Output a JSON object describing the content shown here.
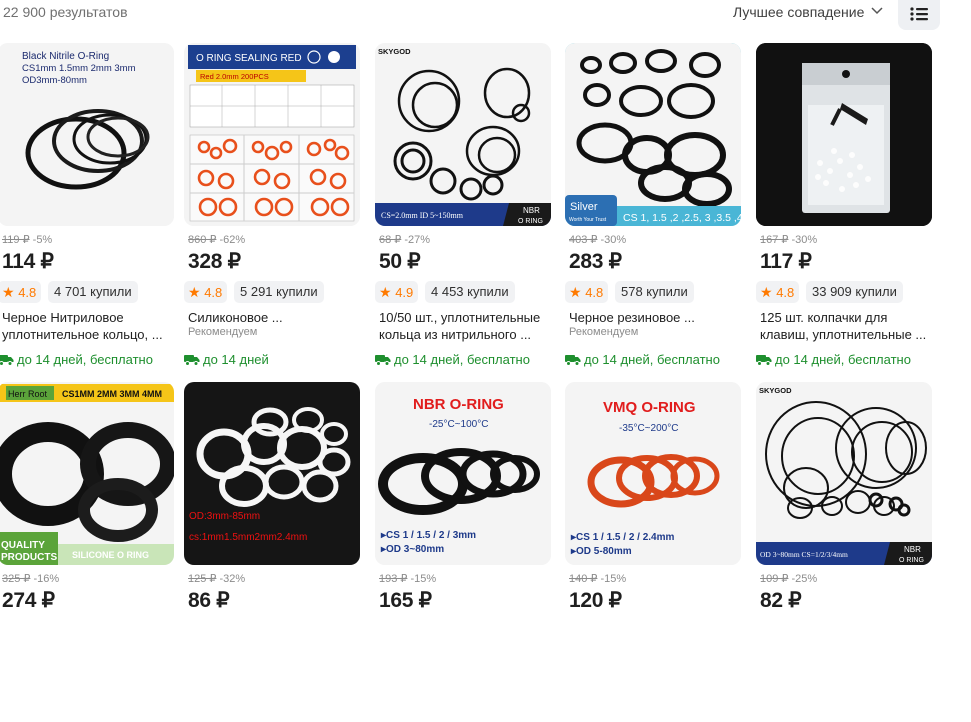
{
  "header": {
    "results": "22 900 результатов",
    "sort_label": "Лучшее совпадение",
    "sort_icon": "chevron-down-icon",
    "view_icon": "list-view-icon"
  },
  "colors": {
    "accent_orange": "#ff7a00",
    "delivery_green": "#1e8f2e",
    "highlight_border": "#7cd3e6"
  },
  "products": [
    {
      "old_price": "119 ₽",
      "discount": "-5%",
      "price": "114 ₽",
      "rating": "4.8",
      "bought": "4 701 купили",
      "title": "Черное Нитриловое уплотнительное кольцо, ...",
      "recommended": "",
      "delivery": "до 14 дней, бесплатно",
      "image_text": [
        "Black Nitrile O-Ring",
        "CS1mm 1.5mm 2mm 3mm",
        "OD3mm-80mm"
      ]
    },
    {
      "old_price": "860 ₽",
      "discount": "-62%",
      "price": "328 ₽",
      "rating": "4.8",
      "bought": "5 291 купили",
      "title": "Силиконовое ...",
      "recommended": "Рекомендуем",
      "delivery": "до 14 дней",
      "image_text": [
        "O RING SEALING RED",
        "Red 2.0mm 200PCS"
      ]
    },
    {
      "old_price": "68 ₽",
      "discount": "-27%",
      "price": "50 ₽",
      "rating": "4.9",
      "bought": "4 453 купили",
      "title": "10/50 шт., уплотнительные кольца из нитрильного ...",
      "recommended": "",
      "delivery": "до 14 дней, бесплатно",
      "image_text": [
        "SKYGOD",
        "CS=2.0mm ID 5~150mm",
        "NBR",
        "O RING"
      ]
    },
    {
      "old_price": "403 ₽",
      "discount": "-30%",
      "price": "283 ₽",
      "rating": "4.8",
      "bought": "578 купили",
      "title": "Черное резиновое ...",
      "recommended": "Рекомендуем",
      "delivery": "до 14 дней, бесплатно",
      "image_text": [
        "Silver",
        "Worth Your Trust",
        "CS 1, 1.5 ,2 ,2.5, 3 ,3.5 ,4"
      ]
    },
    {
      "old_price": "167 ₽",
      "discount": "-30%",
      "price": "117 ₽",
      "rating": "4.8",
      "bought": "33 909 купили",
      "title": "125 шт. колпачки для клавиш, уплотнительные ...",
      "recommended": "",
      "delivery": "до 14 дней, бесплатно",
      "image_text": []
    },
    {
      "old_price": "325 ₽",
      "discount": "-16%",
      "price": "274 ₽",
      "image_text": [
        "Herr Root",
        "CS1MM 2MM 3MM 4MM",
        "QUALITY",
        "PRODUCTS",
        "SILICONE O RING"
      ]
    },
    {
      "old_price": "125 ₽",
      "discount": "-32%",
      "price": "86 ₽",
      "image_text": [
        "OD:3mm-85mm",
        "cs:1mm1.5mm2mm2.4mm"
      ]
    },
    {
      "old_price": "193 ₽",
      "discount": "-15%",
      "price": "165 ₽",
      "image_text": [
        "NBR O-RING",
        "-25°C~100°C",
        "▸CS 1 / 1.5 / 2 / 3mm",
        "▸OD 3~80mm"
      ]
    },
    {
      "old_price": "140 ₽",
      "discount": "-15%",
      "price": "120 ₽",
      "image_text": [
        "VMQ O-RING",
        "-35°C~200°C",
        "▸CS 1 / 1.5 / 2 / 2.4mm",
        "▸OD 5-80mm"
      ]
    },
    {
      "old_price": "109 ₽",
      "discount": "-25%",
      "price": "82 ₽",
      "image_text": [
        "SKYGOD",
        "OD 3~80mm CS=1/2/3/4mm",
        "NBR",
        "O RING"
      ]
    }
  ]
}
